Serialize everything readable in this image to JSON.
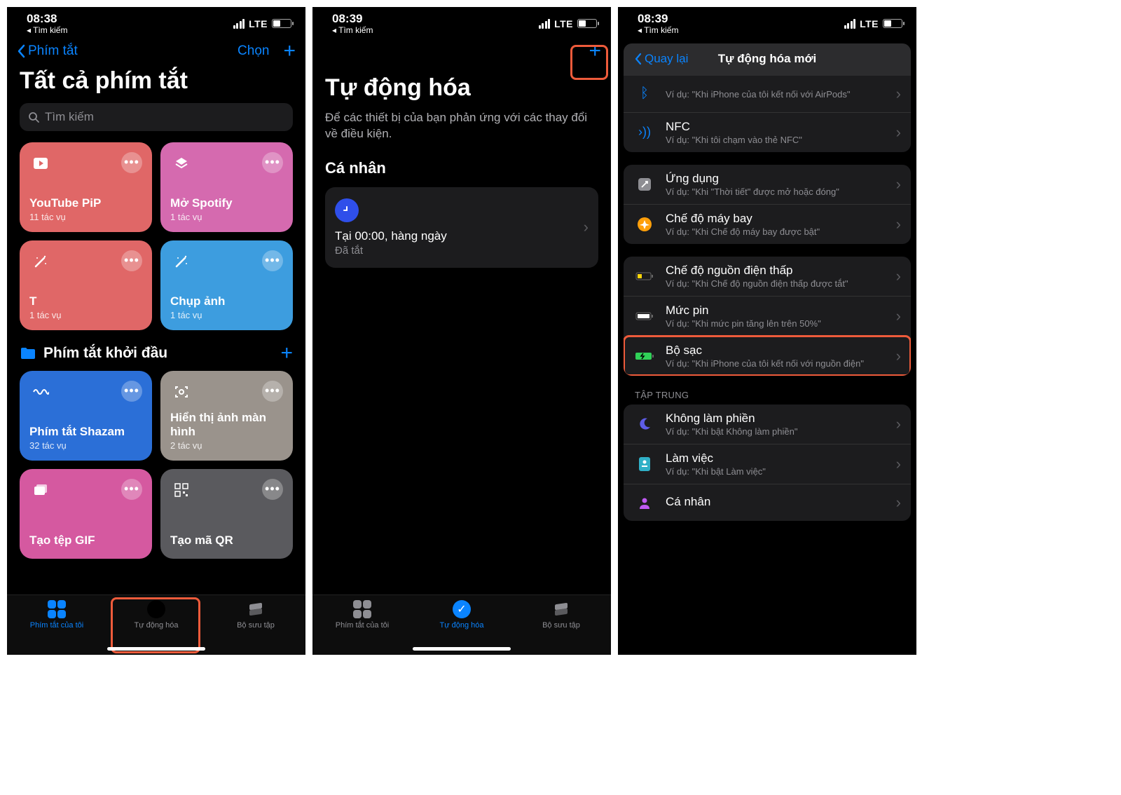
{
  "status": {
    "time_a": "08:38",
    "time_b": "08:39",
    "breadcrumb": "◂ Tìm kiếm",
    "carrier": "LTE"
  },
  "screen1": {
    "back": "Phím tắt",
    "choose": "Chọn",
    "title": "Tất cả phím tắt",
    "search_placeholder": "Tìm kiếm",
    "tiles": [
      {
        "title": "YouTube PiP",
        "sub": "11 tác vụ",
        "color": "#e06767",
        "icon": "play"
      },
      {
        "title": "Mở Spotify",
        "sub": "1 tác vụ",
        "color": "#d56aaf",
        "icon": "layers"
      },
      {
        "title": "T",
        "sub": "1 tác vụ",
        "color": "#e06767",
        "icon": "wand"
      },
      {
        "title": "Chụp ảnh",
        "sub": "1 tác vụ",
        "color": "#3d9ddf",
        "icon": "wand"
      }
    ],
    "section": "Phím tắt khởi đầu",
    "tiles2": [
      {
        "title": "Phím tắt Shazam",
        "sub": "32 tác vụ",
        "color": "#2b6fd7",
        "icon": "wave"
      },
      {
        "title": "Hiển thị ảnh màn hình",
        "sub": "2 tác vụ",
        "color": "#9a938c",
        "icon": "capture"
      },
      {
        "title": "Tạo tệp GIF",
        "sub": "",
        "color": "#d559a0",
        "icon": "photos"
      },
      {
        "title": "Tạo mã QR",
        "sub": "",
        "color": "#5a5a5e",
        "icon": "qr"
      }
    ],
    "tabs": [
      "Phím tắt của tôi",
      "Tự động hóa",
      "Bộ sưu tập"
    ]
  },
  "screen2": {
    "title": "Tự động hóa",
    "subtitle": "Để các thiết bị của bạn phản ứng với các thay đổi về điều kiện.",
    "section": "Cá nhân",
    "card_title": "Tại 00:00, hàng ngày",
    "card_sub": "Đã tắt",
    "tabs": [
      "Phím tắt của tôi",
      "Tự động hóa",
      "Bộ sưu tập"
    ]
  },
  "screen3": {
    "back": "Quay lại",
    "title": "Tự động hóa mới",
    "group1": [
      {
        "icon": "bluetooth",
        "color": "#0a84ff",
        "title": "",
        "sub": "Ví dụ: \"Khi iPhone của tôi kết nối với AirPods\""
      },
      {
        "icon": "nfc",
        "color": "#0a84ff",
        "title": "NFC",
        "sub": "Ví dụ: \"Khi tôi chạm vào thẻ NFC\""
      }
    ],
    "group2": [
      {
        "icon": "app",
        "color": "#8e8e93",
        "title": "Ứng dụng",
        "sub": "Ví dụ: \"Khi \"Thời tiết\" được mở hoặc đóng\""
      },
      {
        "icon": "airplane",
        "color": "#ff9f0a",
        "title": "Chế độ máy bay",
        "sub": "Ví dụ: \"Khi Chế độ máy bay được bật\""
      }
    ],
    "group3": [
      {
        "icon": "lowbat",
        "color": "#ffd60a",
        "title": "Chế độ nguồn điện thấp",
        "sub": "Ví dụ: \"Khi Chế độ nguồn điện thấp được tắt\""
      },
      {
        "icon": "battery",
        "color": "#fff",
        "title": "Mức pin",
        "sub": "Ví dụ: \"Khi mức pin tăng lên trên 50%\""
      },
      {
        "icon": "charger",
        "color": "#30d158",
        "title": "Bộ sạc",
        "sub": "Ví dụ: \"Khi iPhone của tôi kết nối với nguồn điện\"",
        "highlight": true
      }
    ],
    "focus_hdr": "TẬP TRUNG",
    "group4": [
      {
        "icon": "moon",
        "color": "#5e5ce6",
        "title": "Không làm phiền",
        "sub": "Ví dụ: \"Khi bật Không làm phiền\""
      },
      {
        "icon": "badge",
        "color": "#30b0c7",
        "title": "Làm việc",
        "sub": "Ví dụ: \"Khi bật Làm việc\""
      },
      {
        "icon": "person",
        "color": "#bf5af2",
        "title": "Cá nhân",
        "sub": ""
      }
    ]
  }
}
